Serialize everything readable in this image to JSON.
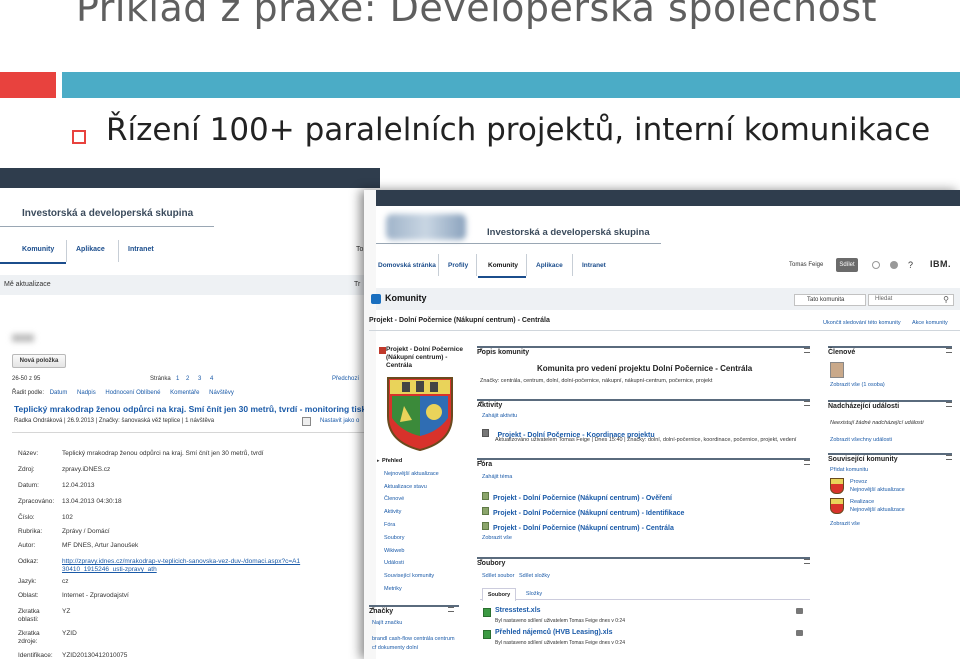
{
  "slide": {
    "title": "Příklad z praxe: Developerská společnost",
    "bullet": "Řízení 100+ paralelních projektů, interní komunikace"
  },
  "shot1": {
    "header": "Investorská a developerská skupina",
    "nav": [
      "Komunity",
      "Aplikace",
      "Intranet",
      "To"
    ],
    "section_label": "Mě aktualizace",
    "right_label": "Tr",
    "new_button": "Nová položka",
    "count": "26-50 z 95",
    "page_label": "Stránka",
    "pages": [
      "1",
      "2",
      "3",
      "4"
    ],
    "prev_label": "Předchozí",
    "sort_label": "Řadit podle:",
    "sort_options": [
      "Datum",
      "Nadpis",
      "Hodnocení Oblíbené",
      "Komentáře",
      "Návštěvy"
    ],
    "article_title": "Teplický mrakodrap ženou odpůrci na kraj. Smí čnít jen 30 metrů, tvrdí - monitoring tisku",
    "article_meta": "Radka Ondráková | 26.9.2013 | Značky: šanovaská věž teplice | 1 návštěva",
    "article_meta_right": "Nastavit jako o",
    "fields": [
      {
        "label": "Název:",
        "value": "Teplický mrakodrap ženou odpůrci na kraj. Smí čnít jen 30 metrů, tvrdí"
      },
      {
        "label": "Zdroj:",
        "value": "zpravy.iDNES.cz"
      },
      {
        "label": "Datum:",
        "value": "12.04.2013"
      },
      {
        "label": "Zpracováno:",
        "value": "13.04.2013 04:30:18"
      },
      {
        "label": "Číslo:",
        "value": "102"
      },
      {
        "label": "Rubrika:",
        "value": "Zprávy / Domácí"
      },
      {
        "label": "Autor:",
        "value": "MF DNES, Artur Janoušek"
      },
      {
        "label": "Odkaz:",
        "value": "http://zpravy.idnes.cz/mrakodrap-v-teplicich-sanovska-vez-duv-/domaci.aspx?c=A130410_1915246_usti-zpravy_ath"
      },
      {
        "label": "Jazyk:",
        "value": "cz"
      },
      {
        "label": "Oblast:",
        "value": "Internet - Zpravodajství"
      },
      {
        "label": "Zkratka oblasti:",
        "value": "YZ"
      },
      {
        "label": "Zkratka zdroje:",
        "value": "YZID"
      },
      {
        "label": "Identifikace:",
        "value": "YZID20130412010075"
      }
    ]
  },
  "shot2": {
    "header": "Investorská a developerská skupina",
    "nav": [
      "Domovská stránka",
      "Profily",
      "Komunity",
      "Aplikace",
      "Intranet"
    ],
    "user": "Tomas Feige",
    "logout": "Sdílet",
    "brand": "IBM.",
    "module": "Komunity",
    "search_scope": "Tato komunita",
    "search_placeholder": "Hledat",
    "breadcrumb": "Projekt - Dolní Počernice (Nákupní centrum) - Centrála",
    "top_right_link": "Ukončit sledování této komunity",
    "actions": "Akce komunity",
    "community_name": "Projekt - Dolní Počernice (Nákupní centrum) - Centrála",
    "left_nav": [
      "Přehled",
      "Nejnovější aktualizace",
      "Aktualizace stavu",
      "Členové",
      "Aktivity",
      "Fóra",
      "Soubory",
      "Wikiweb",
      "Události",
      "Související komunity",
      "Metriky"
    ],
    "tags_head": "Značky",
    "tags_link": "Najít značku",
    "tags_text": "brandl cash-flow centrála centrum cf dokumenty dolní",
    "popis": {
      "head": "Popis komunity",
      "title": "Komunita pro vedení projektu Dolní Počernice - Centrála",
      "tags": "Značky: centrála, centrum, dolní, dolní-počernice, nákupní, nákupní-centrum, počernice, projekt"
    },
    "aktivity": {
      "head": "Aktivity",
      "start": "Zahájit aktivitu",
      "item": "Projekt - Dolní Počernice - Koordinace projektu",
      "meta": "Aktualizováno uživatelem Tomas Feige | Dnes 15:40 | Značky: dolní, dolní-počernice, koordinace, počernice, projekt, vedení"
    },
    "fora": {
      "head": "Fóra",
      "start": "Zahájit téma",
      "items": [
        "Projekt - Dolní Počernice (Nákupní centrum) - Ověření",
        "Projekt - Dolní Počernice (Nákupní centrum) - Identifikace",
        "Projekt - Dolní Počernice (Nákupní centrum) - Centrála"
      ],
      "more": "Zobrazit vše"
    },
    "soubory": {
      "head": "Soubory",
      "links": [
        "Sdílet soubor",
        "Sdílet složky"
      ],
      "tabs": [
        "Soubory",
        "Složky"
      ],
      "files": [
        {
          "name": "Stresstest.xls",
          "meta": "Byl nastaveno sdílení uživatelem Tomas Feige dnes v 0:24"
        },
        {
          "name": "Přehled nájemců (HVB Leasing).xls",
          "meta": "Byl nastaveno sdílení uživatelem Tomas Feige dnes v 0:24"
        }
      ]
    },
    "clenove": {
      "head": "Členové",
      "link": "Zobrazit vše (1 osoba)"
    },
    "udalosti": {
      "head": "Nadcházející události",
      "text": "Neexistují žádné nadcházející události",
      "link": "Zobrazit všechny události"
    },
    "souvisejici": {
      "head": "Související komunity",
      "add": "Přidat komunitu",
      "items": [
        {
          "name": "Provoz",
          "sub": "Nejnovější aktualizace"
        },
        {
          "name": "Realizace",
          "sub": "Nejnovější aktualizace"
        }
      ],
      "more": "Zobrazit vše"
    }
  }
}
